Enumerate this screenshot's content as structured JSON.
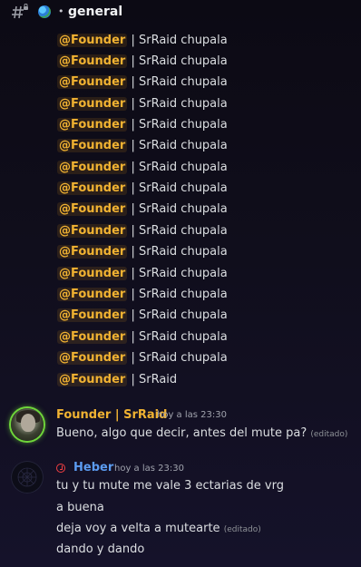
{
  "channel": {
    "name": "general",
    "separator": "•"
  },
  "spam_messages": [
    {
      "mention": "@Founder",
      "separator": "|",
      "text": "SrRaid chupala"
    },
    {
      "mention": "@Founder",
      "separator": "|",
      "text": "SrRaid chupala"
    },
    {
      "mention": "@Founder",
      "separator": "|",
      "text": "SrRaid chupala"
    },
    {
      "mention": "@Founder",
      "separator": "|",
      "text": "SrRaid chupala"
    },
    {
      "mention": "@Founder",
      "separator": "|",
      "text": "SrRaid chupala"
    },
    {
      "mention": "@Founder",
      "separator": "|",
      "text": "SrRaid chupala"
    },
    {
      "mention": "@Founder",
      "separator": "|",
      "text": "SrRaid chupala"
    },
    {
      "mention": "@Founder",
      "separator": "|",
      "text": "SrRaid chupala"
    },
    {
      "mention": "@Founder",
      "separator": "|",
      "text": "SrRaid chupala"
    },
    {
      "mention": "@Founder",
      "separator": "|",
      "text": "SrRaid chupala"
    },
    {
      "mention": "@Founder",
      "separator": "|",
      "text": "SrRaid chupala"
    },
    {
      "mention": "@Founder",
      "separator": "|",
      "text": "SrRaid chupala"
    },
    {
      "mention": "@Founder",
      "separator": "|",
      "text": "SrRaid chupala"
    },
    {
      "mention": "@Founder",
      "separator": "|",
      "text": "SrRaid chupala"
    },
    {
      "mention": "@Founder",
      "separator": "|",
      "text": "SrRaid chupala"
    },
    {
      "mention": "@Founder",
      "separator": "|",
      "text": "SrRaid chupala"
    },
    {
      "mention": "@Founder",
      "separator": "|",
      "text": "SrRaid"
    }
  ],
  "founder_message": {
    "username": "Founder | SrRaid",
    "timestamp": "hoy a las 23:30",
    "text": "Bueno, algo que decir, antes del mute pa?",
    "edited": "(editado)",
    "name_color": "#f0b232"
  },
  "heber_message": {
    "username": "Heber",
    "timestamp": "hoy a las 23:30",
    "name_color": "#5b9bf0",
    "lines": [
      "tu y tu mute me vale 3 ectarias de vrg",
      "a buena",
      "deja voy a velta a mutearte",
      "dando y dando"
    ],
    "line3_edited": "(editado)"
  },
  "icons": {
    "channel": "text-channel-lock-icon",
    "globe": "globe-emoji-icon",
    "timeout": "timeout-clock-icon"
  }
}
